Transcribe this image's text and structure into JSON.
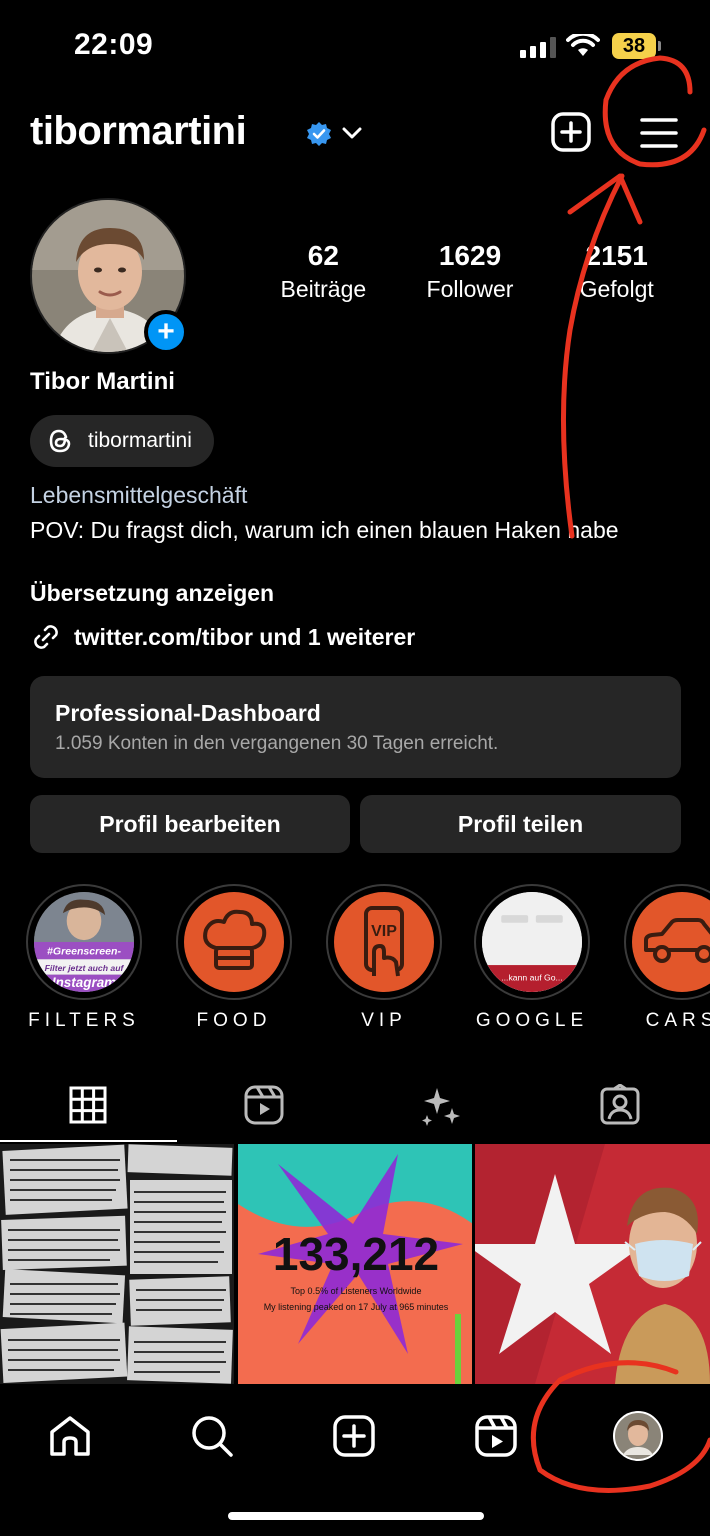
{
  "status_bar": {
    "time": "22:09",
    "battery": "38"
  },
  "header": {
    "username": "tibormartini"
  },
  "profile": {
    "stats": [
      {
        "value": "62",
        "label": "Beiträge"
      },
      {
        "value": "1629",
        "label": "Follower"
      },
      {
        "value": "2151",
        "label": "Gefolgt"
      }
    ],
    "full_name": "Tibor Martini",
    "threads_handle": "tibormartini",
    "category": "Lebensmittelgeschäft",
    "bio": "POV: Du fragst dich, warum ich einen blauen Haken habe",
    "translate_label": "Übersetzung anzeigen",
    "link_text": "twitter.com/tibor und 1 weiterer"
  },
  "dashboard": {
    "title": "Professional-Dashboard",
    "subtitle": "1.059 Konten in den vergangenen 30 Tagen erreicht."
  },
  "buttons": {
    "edit": "Profil bearbeiten",
    "share": "Profil teilen"
  },
  "highlights": [
    {
      "label": "FILTERS",
      "cover_text_1": "#Greenscreen-",
      "cover_text_2": "Filter jetzt auch auf",
      "cover_text_3": "Instagram"
    },
    {
      "label": "FOOD"
    },
    {
      "label": "VIP",
      "icon_text": "VIP"
    },
    {
      "label": "GOOGLE",
      "cover_text": "...kann auf Go..."
    },
    {
      "label": "CARS"
    }
  ],
  "posts": [
    {
      "type": "text-collage"
    },
    {
      "type": "stat",
      "big": "133,212",
      "line1": "Top 0.5% of Listeners Worldwide",
      "line2": "My listening peaked on 17 July at 965 minutes"
    },
    {
      "type": "selfie"
    }
  ],
  "colors": {
    "accent": "#0095f6",
    "highlight_orange": "#e2562a",
    "annotation_red": "#e8321f",
    "surface": "#262626"
  }
}
